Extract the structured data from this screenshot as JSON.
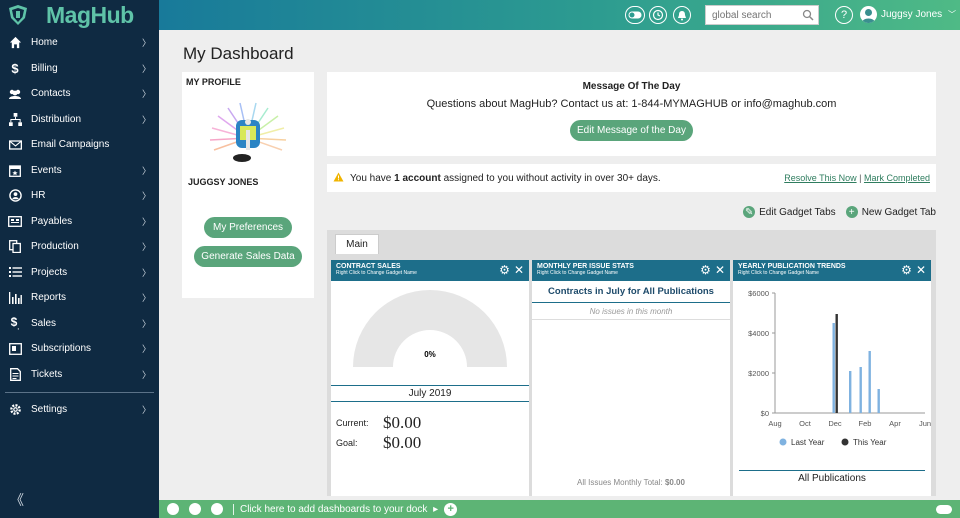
{
  "app": {
    "logo_text": "MagHub"
  },
  "sidebar": {
    "items": [
      {
        "label": "Home",
        "icon": "home-icon",
        "chevron": true
      },
      {
        "label": "Billing",
        "icon": "dollar-icon",
        "chevron": true
      },
      {
        "label": "Contacts",
        "icon": "people-icon",
        "chevron": true
      },
      {
        "label": "Distribution",
        "icon": "sitemap-icon",
        "chevron": true
      },
      {
        "label": "Email Campaigns",
        "icon": "envelope-icon",
        "chevron": false
      },
      {
        "label": "Events",
        "icon": "calendar-icon",
        "chevron": true
      },
      {
        "label": "HR",
        "icon": "hr-icon",
        "chevron": true
      },
      {
        "label": "Payables",
        "icon": "payables-icon",
        "chevron": true
      },
      {
        "label": "Production",
        "icon": "copy-icon",
        "chevron": true
      },
      {
        "label": "Projects",
        "icon": "list-icon",
        "chevron": true
      },
      {
        "label": "Reports",
        "icon": "bar-chart-icon",
        "chevron": true
      },
      {
        "label": "Sales",
        "icon": "sales-icon",
        "chevron": true
      },
      {
        "label": "Subscriptions",
        "icon": "subscriptions-icon",
        "chevron": true
      },
      {
        "label": "Tickets",
        "icon": "ticket-icon",
        "chevron": true
      }
    ],
    "settings_label": "Settings",
    "chevron_glyph": "〉",
    "collapse_glyph": "《"
  },
  "topbar": {
    "search_placeholder": "global search",
    "help_glyph": "?",
    "user_name": "Juggsy Jones",
    "user_chevron": "﹀"
  },
  "page": {
    "title": "My Dashboard"
  },
  "profile": {
    "header": "MY PROFILE",
    "name": "JUGGSY JONES",
    "preferences_button": "My Preferences",
    "generate_button": "Generate Sales Data"
  },
  "motd": {
    "title": "Message Of The Day",
    "text": "Questions about MagHub? Contact us at: 1-844-MYMAGHUB or info@maghub.com",
    "edit_button": "Edit Message of the Day"
  },
  "alert": {
    "prefix": "You have",
    "bold": "1 account",
    "suffix": "assigned to you without activity in over 30+ days.",
    "resolve_link": "Resolve This Now",
    "separator": "|",
    "complete_link": "Mark Completed"
  },
  "gadget_tools": {
    "edit_tabs": "Edit Gadget Tabs",
    "new_tab": "New Gadget Tab"
  },
  "tabs": [
    {
      "label": "Main"
    }
  ],
  "gadgets": {
    "contract_sales": {
      "title": "CONTRACT SALES",
      "subtitle": "Right Click to Change Gadget Name",
      "gauge_percent": 0,
      "gauge_label": "0%",
      "period": "July 2019",
      "current_label": "Current:",
      "current_value": "$0.00",
      "goal_label": "Goal:",
      "goal_value": "$0.00"
    },
    "monthly_issue": {
      "title": "MONTHLY PER ISSUE STATS",
      "subtitle": "Right Click to Change Gadget Name",
      "heading": "Contracts in July for All Publications",
      "empty_text": "No issues in this month",
      "total_label": "All Issues Monthly Total:",
      "total_value": "$0.00"
    },
    "yearly_trends": {
      "title": "YEARLY PUBLICATION TRENDS",
      "subtitle": "Right Click to Change Gadget Name",
      "footer": "All Publications"
    }
  },
  "chart_data": {
    "type": "bar",
    "categories": [
      "Aug",
      "Oct",
      "Dec",
      "Feb",
      "Apr",
      "Jun"
    ],
    "ytick_labels": [
      "$6000",
      "$4000",
      "$2000",
      "$0"
    ],
    "ylim": [
      0,
      6000
    ],
    "series": [
      {
        "name": "Last Year",
        "color": "#7fb2e0",
        "points": [
          {
            "x": 8.7,
            "y": 0
          },
          {
            "x": 11.9,
            "y": 4500
          },
          {
            "x": 13.0,
            "y": 2100
          },
          {
            "x": 13.7,
            "y": 2300
          },
          {
            "x": 14.3,
            "y": 3100
          },
          {
            "x": 14.9,
            "y": 1200
          }
        ]
      },
      {
        "name": "This Year",
        "color": "#333333",
        "points": [
          {
            "x": 12.1,
            "y": 4950
          }
        ]
      }
    ],
    "legend": "bottom",
    "grid": false
  },
  "dock": {
    "text": "Click here to add dashboards to your dock",
    "arrow": "▸",
    "plus": "+"
  }
}
